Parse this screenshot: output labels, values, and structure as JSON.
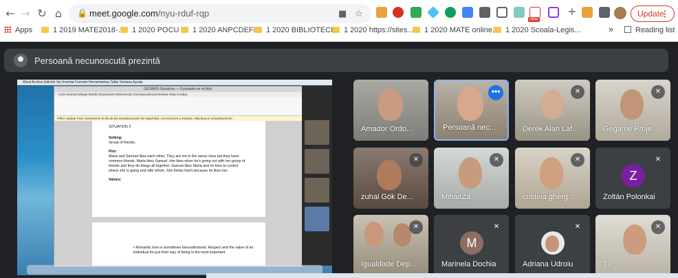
{
  "browser": {
    "url_host": "meet.google.com",
    "url_path": "/nyu-rduf-rqp",
    "update_label": "Update",
    "apps_label": "Apps",
    "overflow_label": "»",
    "reading_list_label": "Reading list",
    "extension_badge": "new",
    "bookmarks": [
      "1 2019 MATE2018-...",
      "1 2020  POCU",
      "1 2020 ANPCDEFP",
      "1 2020 BIBLIOTECI...",
      "1 2020 https://sites....",
      "1 2020 MATE online...",
      "1 2020 Scoala-Legis..."
    ]
  },
  "meet": {
    "presenter_banner": "Persoană necunoscută prezintă",
    "participants": [
      {
        "name": "Amador Ordo...",
        "muted": false
      },
      {
        "name": "Persoană nec...",
        "muted": false,
        "active": true
      },
      {
        "name": "Derek Alan Laf...",
        "muted": true
      },
      {
        "name": "Gegame Proje...",
        "muted": true
      },
      {
        "name": "zuhal Gök De...",
        "muted": true
      },
      {
        "name": "MihaitZa",
        "muted": true
      },
      {
        "name": "cristina gherg...",
        "muted": true
      },
      {
        "name": "Zoltán Polonkai",
        "muted": true,
        "initial": "Z",
        "avatar_color": "#7b1fa2"
      },
      {
        "name": "Igualdade Dep...",
        "muted": true
      },
      {
        "name": "Marinela Dochia",
        "muted": true,
        "initial": "M",
        "avatar_color": "#8d6e63"
      },
      {
        "name": "Adriana Udroiu",
        "muted": true
      },
      {
        "name": "Tu",
        "muted": true
      }
    ]
  },
  "shared_screen": {
    "word_title": "GESAMS-Situations — Guardado en mi Mac",
    "menu": "Word  Archivo  Edición  Ver  Insertar  Formato  Herramientas  Tabla  Ventana  Ayuda",
    "tabs": "Inicio  Insertar  Dibujar  Diseño  Disposición  Referencias  Correspondencia  Revisar  Vista  Acrobat",
    "notice": "Office Update  Para mantenerse al día de las actualizaciones de seguridad, correcciones y mejoras, elija Buscar actualizaciones.",
    "doc_lines": [
      {
        "text": "SITUATION 2",
        "bold": false
      },
      {
        "text": "Setting:",
        "bold": true
      },
      {
        "text": "Group of friends.",
        "bold": false
      },
      {
        "text": "Plot:",
        "bold": true
      },
      {
        "text": "Maria and Samuel likes each other. They are not in the same class but they have",
        "bold": false
      },
      {
        "text": "common friends. Maria likes Samuel, she likes when he's going out with her group of",
        "bold": false
      },
      {
        "text": "friends and they do things all together. Samuel likes Maria and he tries to control",
        "bold": false
      },
      {
        "text": "where she is going and with whom. She thinks that's because he likes her.",
        "bold": false
      },
      {
        "text": "Values:",
        "bold": true
      }
    ],
    "page2_lines": [
      "•      Romantic love is sometimes misunderstood. Respect and the value of an",
      "        individual for just their way of being is the most important."
    ]
  }
}
